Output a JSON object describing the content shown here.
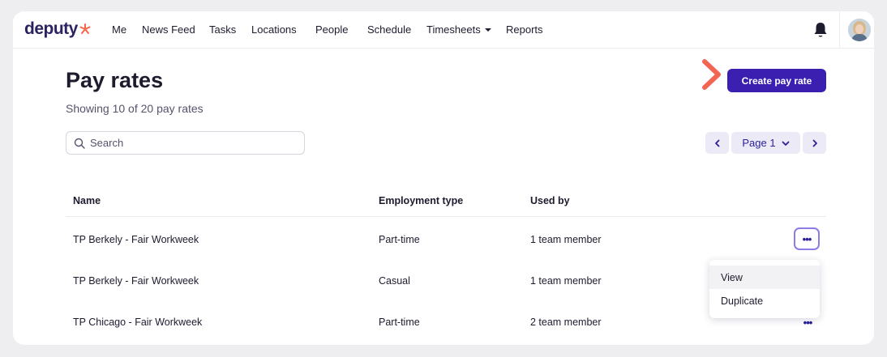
{
  "brand": {
    "name": "deputy",
    "accent": "#f2664b",
    "primary": "#3a1fb0"
  },
  "nav": {
    "items": [
      "Me",
      "News Feed",
      "Tasks",
      "Locations",
      "People",
      "Schedule",
      "Timesheets",
      "Reports"
    ]
  },
  "page": {
    "title": "Pay rates",
    "subtitle": "Showing 10 of 20 pay rates",
    "create_label": "Create pay rate"
  },
  "search": {
    "placeholder": "Search",
    "value": ""
  },
  "pager": {
    "page_label": "Page 1"
  },
  "table": {
    "headers": [
      "Name",
      "Employment type",
      "Used by"
    ],
    "rows": [
      {
        "name": "TP Berkely - Fair Workweek",
        "type": "Part-time",
        "used": "1 team member"
      },
      {
        "name": "TP Berkely - Fair Workweek",
        "type": "Casual",
        "used": "1 team member"
      },
      {
        "name": "TP Chicago - Fair Workweek",
        "type": "Part-time",
        "used": "2 team member"
      }
    ]
  },
  "row_menu": {
    "items": [
      "View",
      "Duplicate"
    ]
  },
  "icons": {
    "more": "•••"
  }
}
